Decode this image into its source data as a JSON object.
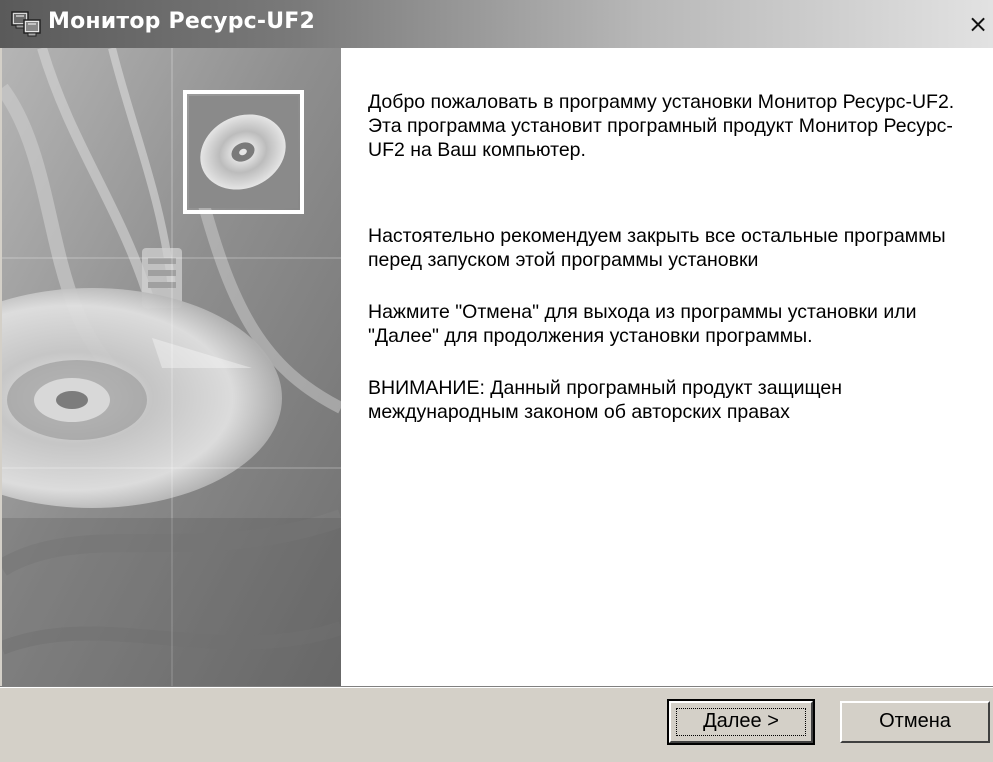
{
  "window": {
    "title": "Монитор Ресурс-UF2",
    "close_glyph": "×",
    "icon": "installer-computer-icon"
  },
  "side_image": {
    "description_icon": "cd-disc-illustration"
  },
  "content": {
    "paragraphs": [
      "Добро пожаловать в программу установки Монитор Ресурс-UF2. Эта программа установит програмный продукт Монитор Ресурс-UF2 на Ваш компьютер.",
      "Настоятельно рекомендуем закрыть все остальные программы перед запуском этой программы установки",
      "Нажмите \"Отмена\" для выхода из программы установки или \"Далее\" для продолжения установки программы.",
      "ВНИМАНИЕ: Данный програмный продукт защищен международным законом об авторских правах"
    ]
  },
  "buttons": {
    "next_accel": "Д",
    "next_rest": "алее >",
    "cancel": "Отмена"
  },
  "colors": {
    "title_gradient_start": "#5a5a5a",
    "title_gradient_end": "#e2e2e2",
    "dialog_face": "#d4d0c8",
    "content_bg": "#ffffff"
  }
}
